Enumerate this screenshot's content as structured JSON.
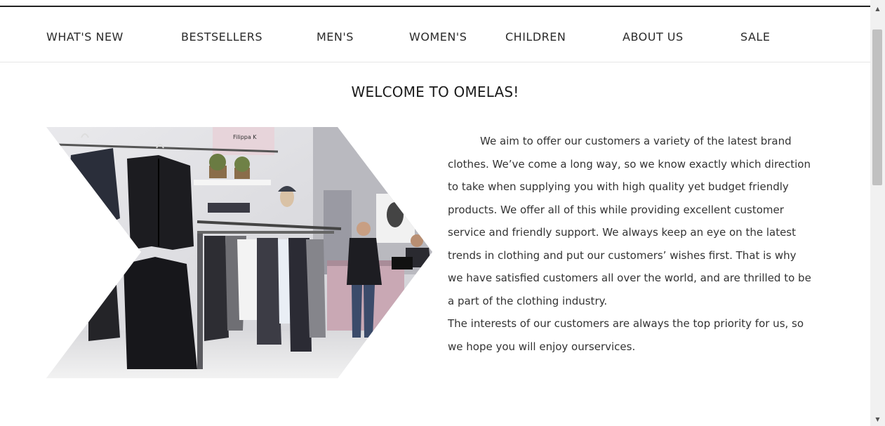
{
  "nav": {
    "items": [
      {
        "label": "WHAT'S NEW"
      },
      {
        "label": "BESTSELLERS"
      },
      {
        "label": "MEN'S"
      },
      {
        "label": "WOMEN'S"
      },
      {
        "label": "CHILDREN"
      },
      {
        "label": "ABOUT US"
      },
      {
        "label": "SALE"
      }
    ]
  },
  "main": {
    "title": "WELCOME TO OMELAS!",
    "paragraph1": "We aim to offer our customers a variety of the latest brand clothes. We’ve come a long way, so we know exactly which direction to take when supplying you with high quality yet budget friendly products. We offer all of this while providing excellent customer service and friendly support. We always keep an eye on the latest trends in clothing and put our customers’ wishes first. That is why we have satisfied customers all over the world, and are thrilled to be a part of the clothing industry.",
    "paragraph2": "The interests of our customers are always the top priority for us, so we hope you will enjoy ourservices.",
    "image": {
      "store_sign": "Filippa K"
    }
  },
  "scrollbar": {
    "up_icon": "triangle-up-icon",
    "down_icon": "triangle-down-icon"
  }
}
